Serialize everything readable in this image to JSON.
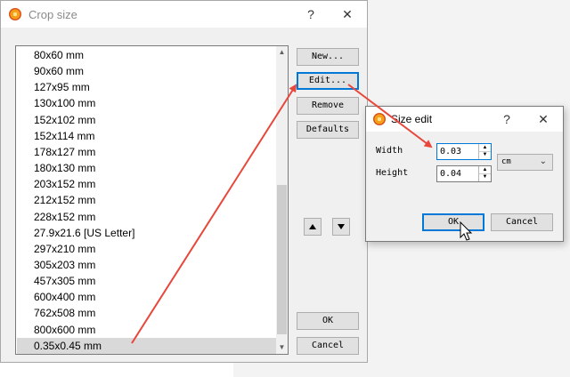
{
  "crop_dialog": {
    "title": "Crop size",
    "help_glyph": "?",
    "close_glyph": "✕",
    "items": [
      "80x60 mm",
      "90x60 mm",
      "127x95 mm",
      "130x100 mm",
      "152x102 mm",
      "152x114 mm",
      "178x127 mm",
      "180x130 mm",
      "203x152 mm",
      "212x152 mm",
      "228x152 mm",
      "27.9x21.6 [US Letter]",
      "297x210 mm",
      "305x203 mm",
      "457x305 mm",
      "600x400 mm",
      "762x508 mm",
      "800x600 mm",
      "0.35x0.45 mm"
    ],
    "selected_item": "0.35x0.45 mm",
    "buttons": {
      "new": "New...",
      "edit": "Edit...",
      "remove": "Remove",
      "defaults": "Defaults",
      "ok": "OK",
      "cancel": "Cancel"
    }
  },
  "size_dialog": {
    "title": "Size edit",
    "help_glyph": "?",
    "close_glyph": "✕",
    "width_label": "Width",
    "width_value": "0.03",
    "height_label": "Height",
    "height_value": "0.04",
    "unit": "cm",
    "ok": "OK",
    "cancel": "Cancel"
  },
  "colors": {
    "annotation_arrow": "#e8473b",
    "focus_blue": "#0078d7",
    "selection": "#d9d9d9"
  }
}
